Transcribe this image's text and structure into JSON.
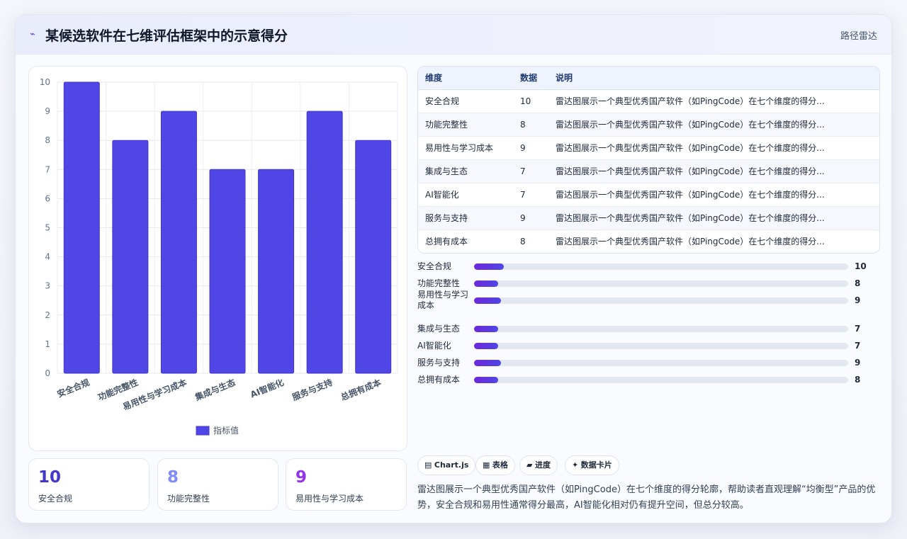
{
  "header": {
    "title": "某候选软件在七维评估框架中的示意得分",
    "badge": "路径雷达"
  },
  "chart_data": {
    "type": "bar",
    "categories": [
      "安全合规",
      "功能完整性",
      "易用性与学习成本",
      "集成与生态",
      "AI智能化",
      "服务与支持",
      "总拥有成本"
    ],
    "series": [
      {
        "name": "指标值",
        "values": [
          10,
          8,
          9,
          7,
          7,
          9,
          8
        ]
      }
    ],
    "ylim": [
      0,
      10
    ],
    "yticks": [
      0,
      1,
      2,
      3,
      4,
      5,
      6,
      7,
      8,
      9,
      10
    ],
    "grid": true,
    "legend": "bottom",
    "color": "#4f46e5"
  },
  "stats": [
    {
      "value": "10",
      "label": "安全合规",
      "color": "#4338ca"
    },
    {
      "value": "8",
      "label": "功能完整性",
      "color": "#818cf8"
    },
    {
      "value": "9",
      "label": "易用性与学习成本",
      "color": "#9333ea"
    }
  ],
  "table": {
    "headers": [
      "维度",
      "数据",
      "说明"
    ],
    "rows": [
      {
        "dim": "安全合规",
        "val": "10",
        "note": "雷达图展示一个典型优秀国产软件（如PingCode）在七个维度的得分..."
      },
      {
        "dim": "功能完整性",
        "val": "8",
        "note": "雷达图展示一个典型优秀国产软件（如PingCode）在七个维度的得分..."
      },
      {
        "dim": "易用性与学习成本",
        "val": "9",
        "note": "雷达图展示一个典型优秀国产软件（如PingCode）在七个维度的得分..."
      },
      {
        "dim": "集成与生态",
        "val": "7",
        "note": "雷达图展示一个典型优秀国产软件（如PingCode）在七个维度的得分..."
      },
      {
        "dim": "AI智能化",
        "val": "7",
        "note": "雷达图展示一个典型优秀国产软件（如PingCode）在七个维度的得分..."
      },
      {
        "dim": "服务与支持",
        "val": "9",
        "note": "雷达图展示一个典型优秀国产软件（如PingCode）在七个维度的得分..."
      },
      {
        "dim": "总拥有成本",
        "val": "8",
        "note": "雷达图展示一个典型优秀国产软件（如PingCode）在七个维度的得分..."
      }
    ]
  },
  "progress": [
    {
      "label": "安全合规",
      "value": "10",
      "fraction": 0.08
    },
    {
      "label": "功能完整性",
      "value": "8",
      "fraction": 0.064
    },
    {
      "label": "易用性与学习成本",
      "value": "9",
      "fraction": 0.072
    },
    {
      "label": "集成与生态",
      "value": "7",
      "fraction": 0.064
    },
    {
      "label": "AI智能化",
      "value": "7",
      "fraction": 0.064
    },
    {
      "label": "服务与支持",
      "value": "9",
      "fraction": 0.072
    },
    {
      "label": "总拥有成本",
      "value": "8",
      "fraction": 0.064
    }
  ],
  "chips": [
    {
      "icon": "▤",
      "label": "Chart.js"
    },
    {
      "icon": "▦",
      "label": "表格"
    },
    {
      "icon": "▰",
      "label": "进度"
    },
    {
      "icon": "✦",
      "label": "数据卡片"
    }
  ],
  "description": "雷达图展示一个典型优秀国产软件（如PingCode）在七个维度的得分轮廓，帮助读者直观理解“均衡型”产品的优势，安全合规和易用性通常得分最高，AI智能化相对仍有提升空间，但总分较高。"
}
